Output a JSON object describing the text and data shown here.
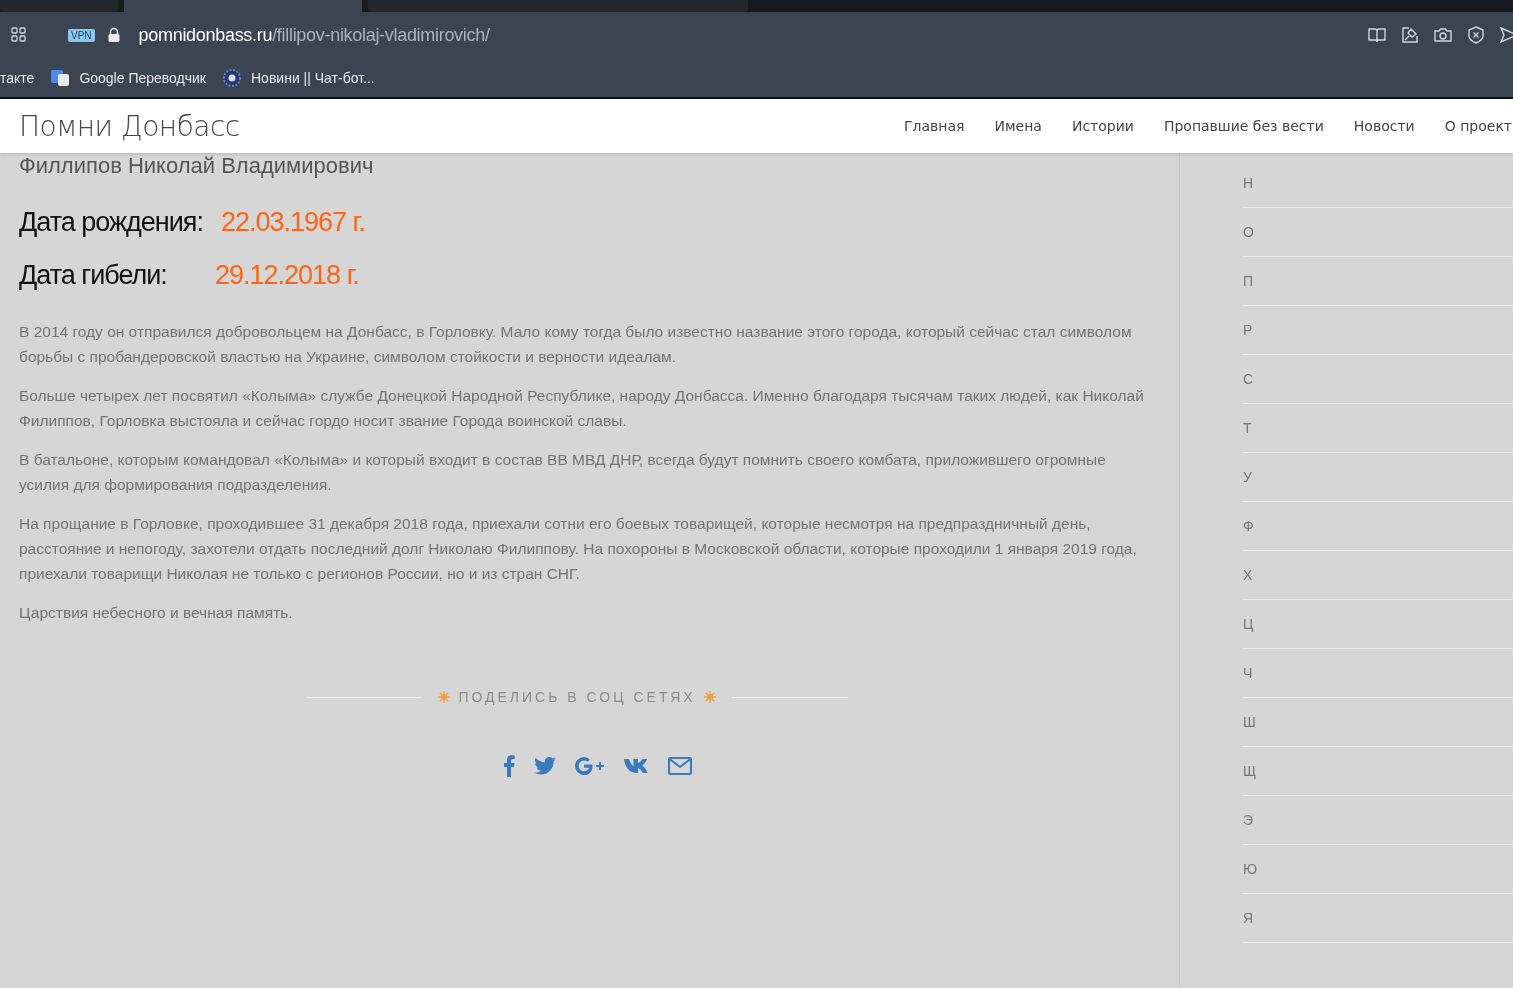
{
  "browser": {
    "tabs": [
      {
        "selected": false
      },
      {
        "selected": true
      },
      {
        "selected": false
      }
    ],
    "address": {
      "domain": "pomnidonbass.ru",
      "path": "/fillipov-nikolaj-vladimirovich/"
    },
    "vpn_badge": "VPN",
    "bookmarks": [
      {
        "label": "такте",
        "kind": "plain"
      },
      {
        "label": "Google Переводчик",
        "kind": "translate"
      },
      {
        "label": "Новини || Чат-бот...",
        "kind": "emblem"
      }
    ]
  },
  "site": {
    "logo": "Помни Донбасс",
    "nav": [
      "Главная",
      "Имена",
      "Истории",
      "Пропавшие без вести",
      "Новости",
      "О проект"
    ]
  },
  "article": {
    "name": "Филлипов Николай Владимирович",
    "dates": [
      {
        "label": "Дата рождения:",
        "value": "22.03.1967 г."
      },
      {
        "label": "Дата гибели:",
        "value": "29.12.2018 г."
      }
    ],
    "paragraphs": [
      "В 2014 году он отправился добровольцем на Донбасс, в Горловку. Мало кому тогда было известно название этого города, который сейчас стал символом борьбы с пробандеровской властью на Украине, символом стойкости и верности идеалам.",
      "Больше четырех лет посвятил «Колыма» службе Донецкой Народной Республике, народу Донбасса. Именно благодаря тысячам таких людей, как Николай Филиппов, Горловка выстояла и сейчас гордо носит звание Города воинской славы.",
      "В батальоне, которым командовал «Колыма» и который входит в состав ВВ МВД ДНР, всегда будут помнить своего комбата, приложившего огромные усилия для формирования подразделения.",
      "На прощание в Горловке, проходившее 31 декабря 2018 года, приехали сотни его боевых товарищей, которые несмотря на предпраздничный день, расстояние и непогоду, захотели отдать последний долг Николаю Филиппову. На похороны в Московской области, которые проходили 1 января 2019 года, приехали товарищи Николая не только с регионов России, но и из стран СНГ.",
      "Царствия небесного и вечная память."
    ],
    "share": {
      "title": "ПОДЕЛИСЬ В СОЦ СЕТЯХ",
      "buttons": [
        {
          "kind": "facebook"
        },
        {
          "kind": "twitter"
        },
        {
          "kind": "gplus"
        },
        {
          "kind": "vk"
        },
        {
          "kind": "mail"
        }
      ]
    }
  },
  "sidebar": {
    "letters": [
      "Н",
      "О",
      "П",
      "Р",
      "С",
      "Т",
      "У",
      "Ф",
      "Х",
      "Ц",
      "Ч",
      "Ш",
      "Щ",
      "Э",
      "Ю",
      "Я"
    ]
  }
}
